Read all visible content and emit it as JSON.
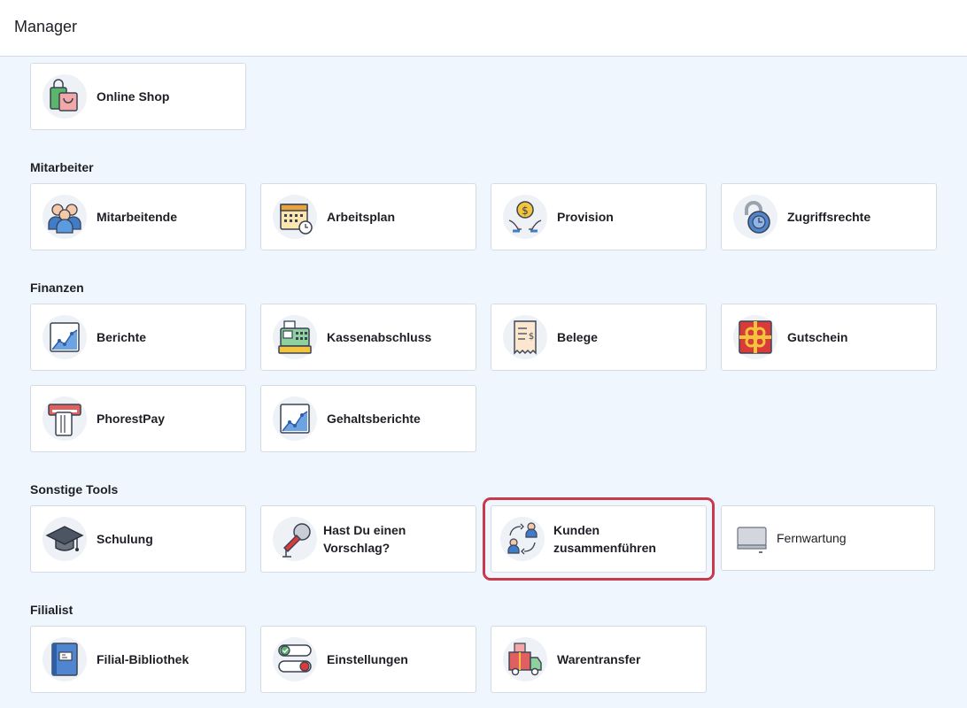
{
  "header": {
    "title": "Manager"
  },
  "sections": [
    {
      "title": ""
    },
    {
      "title": "Mitarbeiter"
    },
    {
      "title": "Finanzen"
    },
    {
      "title": "Sonstige Tools"
    },
    {
      "title": "Filialist"
    }
  ],
  "cards": {
    "online_shop": {
      "label": "Online Shop",
      "icon": "shopping-bag-icon"
    },
    "mitarbeitende": {
      "label": "Mitarbeitende",
      "icon": "staff-icon"
    },
    "arbeitsplan": {
      "label": "Arbeitsplan",
      "icon": "calendar-icon"
    },
    "provision": {
      "label": "Provision",
      "icon": "commission-icon"
    },
    "zugriffsrechte": {
      "label": "Zugriffsrechte",
      "icon": "lock-icon"
    },
    "berichte": {
      "label": "Berichte",
      "icon": "chart-icon"
    },
    "kassenabschluss": {
      "label": "Kassenabschluss",
      "icon": "cash-register-icon"
    },
    "belege": {
      "label": "Belege",
      "icon": "receipt-icon"
    },
    "gutschein": {
      "label": "Gutschein",
      "icon": "gift-icon"
    },
    "phorestpay": {
      "label": "PhorestPay",
      "icon": "card-terminal-icon"
    },
    "gehaltsberichte": {
      "label": "Gehaltsberichte",
      "icon": "chart-icon"
    },
    "schulung": {
      "label": "Schulung",
      "icon": "graduation-cap-icon"
    },
    "vorschlag": {
      "label": "Hast Du einen Vorschlag?",
      "icon": "microphone-icon"
    },
    "kunden": {
      "label": "Kunden zusammenführen",
      "icon": "merge-customers-icon"
    },
    "fernwartung": {
      "label": "Fernwartung",
      "icon": "monitor-icon"
    },
    "bibliothek": {
      "label": "Filial-Bibliothek",
      "icon": "book-icon"
    },
    "einstellungen": {
      "label": "Einstellungen",
      "icon": "toggle-icon"
    },
    "warentransfer": {
      "label": "Warentransfer",
      "icon": "delivery-truck-icon"
    }
  },
  "colors": {
    "background": "#f0f6fd",
    "card": "#ffffff",
    "highlight": "#c8394c",
    "icon_blue": "#3f7cc9",
    "icon_outline": "#3b4252"
  }
}
